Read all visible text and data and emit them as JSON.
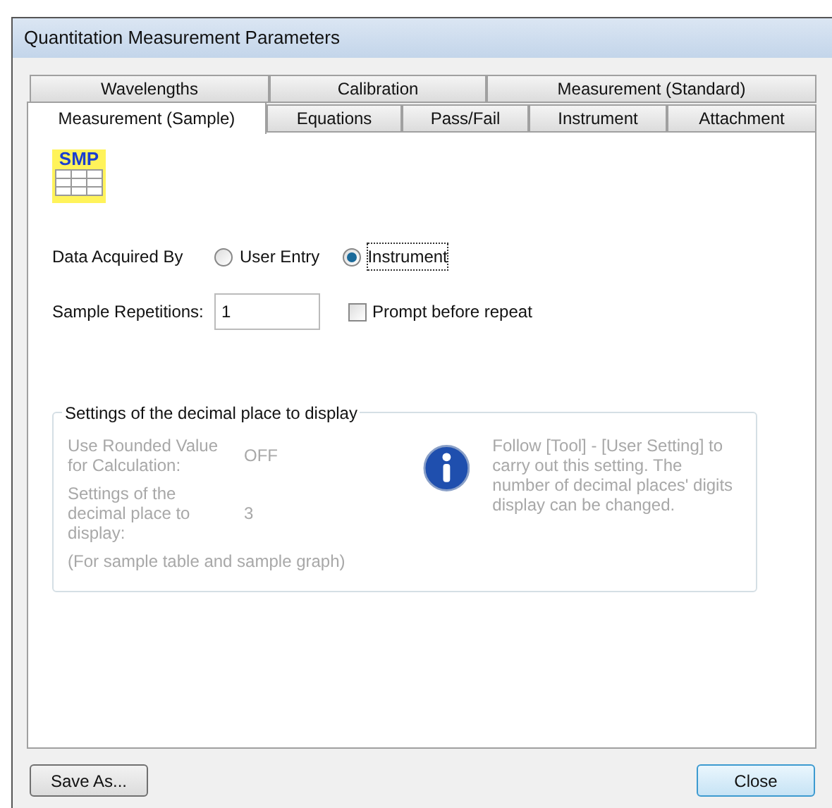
{
  "window": {
    "title": "Quantitation Measurement Parameters"
  },
  "tab_rows": [
    [
      {
        "label": "Wavelengths",
        "selected": false
      },
      {
        "label": "Calibration",
        "selected": false
      },
      {
        "label": "Measurement (Standard)",
        "selected": false
      }
    ],
    [
      {
        "label": "Measurement (Sample)",
        "selected": true
      },
      {
        "label": "Equations",
        "selected": false
      },
      {
        "label": "Pass/Fail",
        "selected": false
      },
      {
        "label": "Instrument",
        "selected": false
      },
      {
        "label": "Attachment",
        "selected": false
      }
    ]
  ],
  "badge": {
    "text": "SMP"
  },
  "data_acquired": {
    "label": "Data Acquired By",
    "options": [
      {
        "label": "User Entry",
        "selected": false
      },
      {
        "label": "Instrument",
        "selected": true
      }
    ]
  },
  "sample_repetitions": {
    "label": "Sample Repetitions:",
    "value": "1"
  },
  "prompt_checkbox": {
    "label": "Prompt before repeat",
    "checked": false
  },
  "decimal_group": {
    "title": "Settings of the decimal place to display",
    "rows": [
      {
        "label": "Use Rounded Value for Calculation:",
        "value": "OFF"
      },
      {
        "label": "Settings of the decimal place to display:",
        "value": "3"
      }
    ],
    "footnote": "(For sample table and sample graph)",
    "note": "Follow [Tool] - [User Setting] to carry out this setting. The number of decimal places' digits display can be changed."
  },
  "buttons": [
    {
      "label": "Save As...",
      "kind": "normal"
    },
    {
      "label": "Close",
      "kind": "default"
    }
  ]
}
